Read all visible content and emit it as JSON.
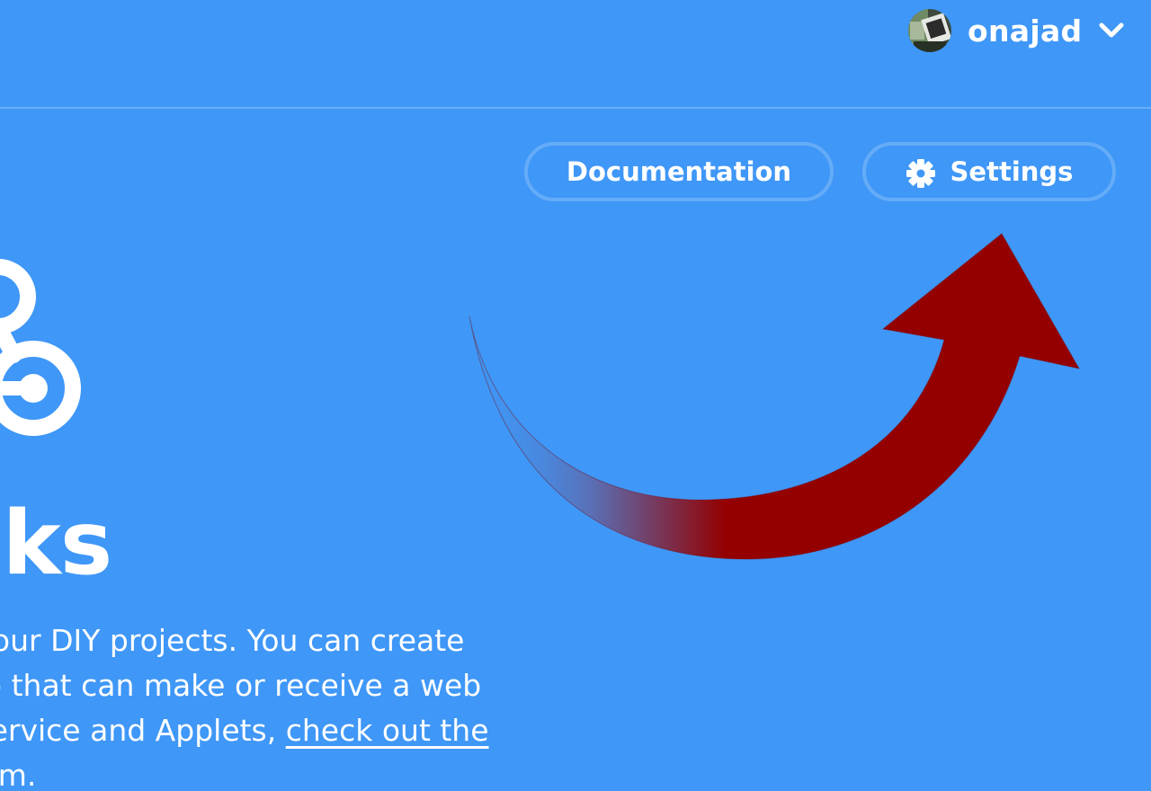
{
  "header": {
    "username": "onajad",
    "avatar_icon": "user-avatar",
    "menu_icon": "chevron-down-icon"
  },
  "toolbar": {
    "documentation_label": "Documentation",
    "settings_label": "Settings",
    "settings_icon": "gear-icon"
  },
  "service": {
    "logo_icon": "webhooks-logo",
    "title": "ooks",
    "description_lines": [
      "n your DIY projects. You can create",
      "app that can make or receive a web",
      "n service and Applets, "
    ],
    "link_line3": "check out the",
    "link_line4": "tform",
    "line4_suffix": "."
  },
  "annotation": {
    "arrow_color": "#940000",
    "arrow_fade_color": "#3f97f7"
  },
  "colors": {
    "background": "#3f97f7",
    "button_border": "#65acf8",
    "text": "#ffffff"
  }
}
